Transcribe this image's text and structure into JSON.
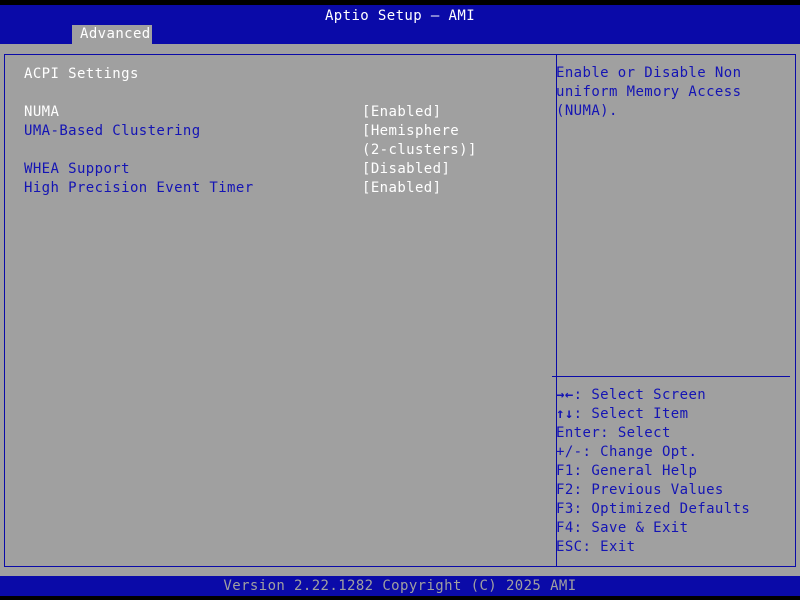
{
  "title_bar": {
    "title": "Aptio Setup – AMI",
    "tabs": [
      {
        "label": "Advanced"
      }
    ]
  },
  "main": {
    "section_title": "ACPI Settings",
    "settings": [
      {
        "label": "NUMA",
        "value": "[Enabled]"
      },
      {
        "label": "UMA-Based Clustering",
        "value": "[Hemisphere\n(2-clusters)]"
      },
      {
        "label": "WHEA Support",
        "value": "[Disabled]"
      },
      {
        "label": "High Precision Event Timer",
        "value": "[Enabled]"
      }
    ]
  },
  "help": {
    "description": "Enable or Disable Non\nuniform Memory Access\n(NUMA).",
    "keys": [
      {
        "key": "→←",
        "action": ": Select Screen"
      },
      {
        "key": "↑↓",
        "action": ": Select Item"
      },
      {
        "key": "Enter",
        "action": ": Select"
      },
      {
        "key": "+/-",
        "action": ": Change Opt."
      },
      {
        "key": "F1",
        "action": ": General Help"
      },
      {
        "key": "F2",
        "action": ": Previous Values"
      },
      {
        "key": "F3",
        "action": ": Optimized Defaults"
      },
      {
        "key": "F4",
        "action": ": Save & Exit"
      },
      {
        "key": "ESC",
        "action": ": Exit"
      }
    ]
  },
  "footer": {
    "version": "Version 2.22.1282 Copyright (C) 2025 AMI"
  },
  "colors": {
    "background": "#a0a0a0",
    "bar_blue": "#0a0aa8",
    "label_blue": "#1414b4",
    "highlight": "#ffffff"
  }
}
